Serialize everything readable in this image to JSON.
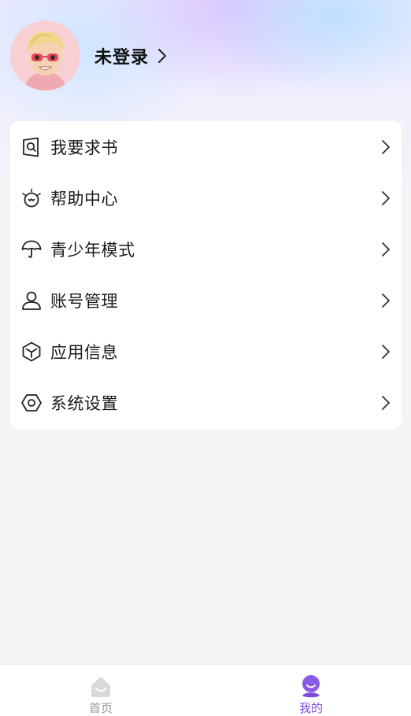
{
  "profile": {
    "login_label": "未登录"
  },
  "menu": {
    "items": [
      {
        "label": "我要求书",
        "icon": "book-request-icon"
      },
      {
        "label": "帮助中心",
        "icon": "help-center-icon"
      },
      {
        "label": "青少年模式",
        "icon": "umbrella-icon"
      },
      {
        "label": "账号管理",
        "icon": "user-icon"
      },
      {
        "label": "应用信息",
        "icon": "cube-icon"
      },
      {
        "label": "系统设置",
        "icon": "settings-icon"
      }
    ]
  },
  "tabbar": {
    "tabs": [
      {
        "label": "首页",
        "icon": "home-icon",
        "active": false
      },
      {
        "label": "我的",
        "icon": "profile-icon",
        "active": true
      }
    ]
  },
  "colors": {
    "accent": "#7c4ddb",
    "inactive_tab": "#999999",
    "card": "#ffffff",
    "background": "#f4f4f6"
  }
}
